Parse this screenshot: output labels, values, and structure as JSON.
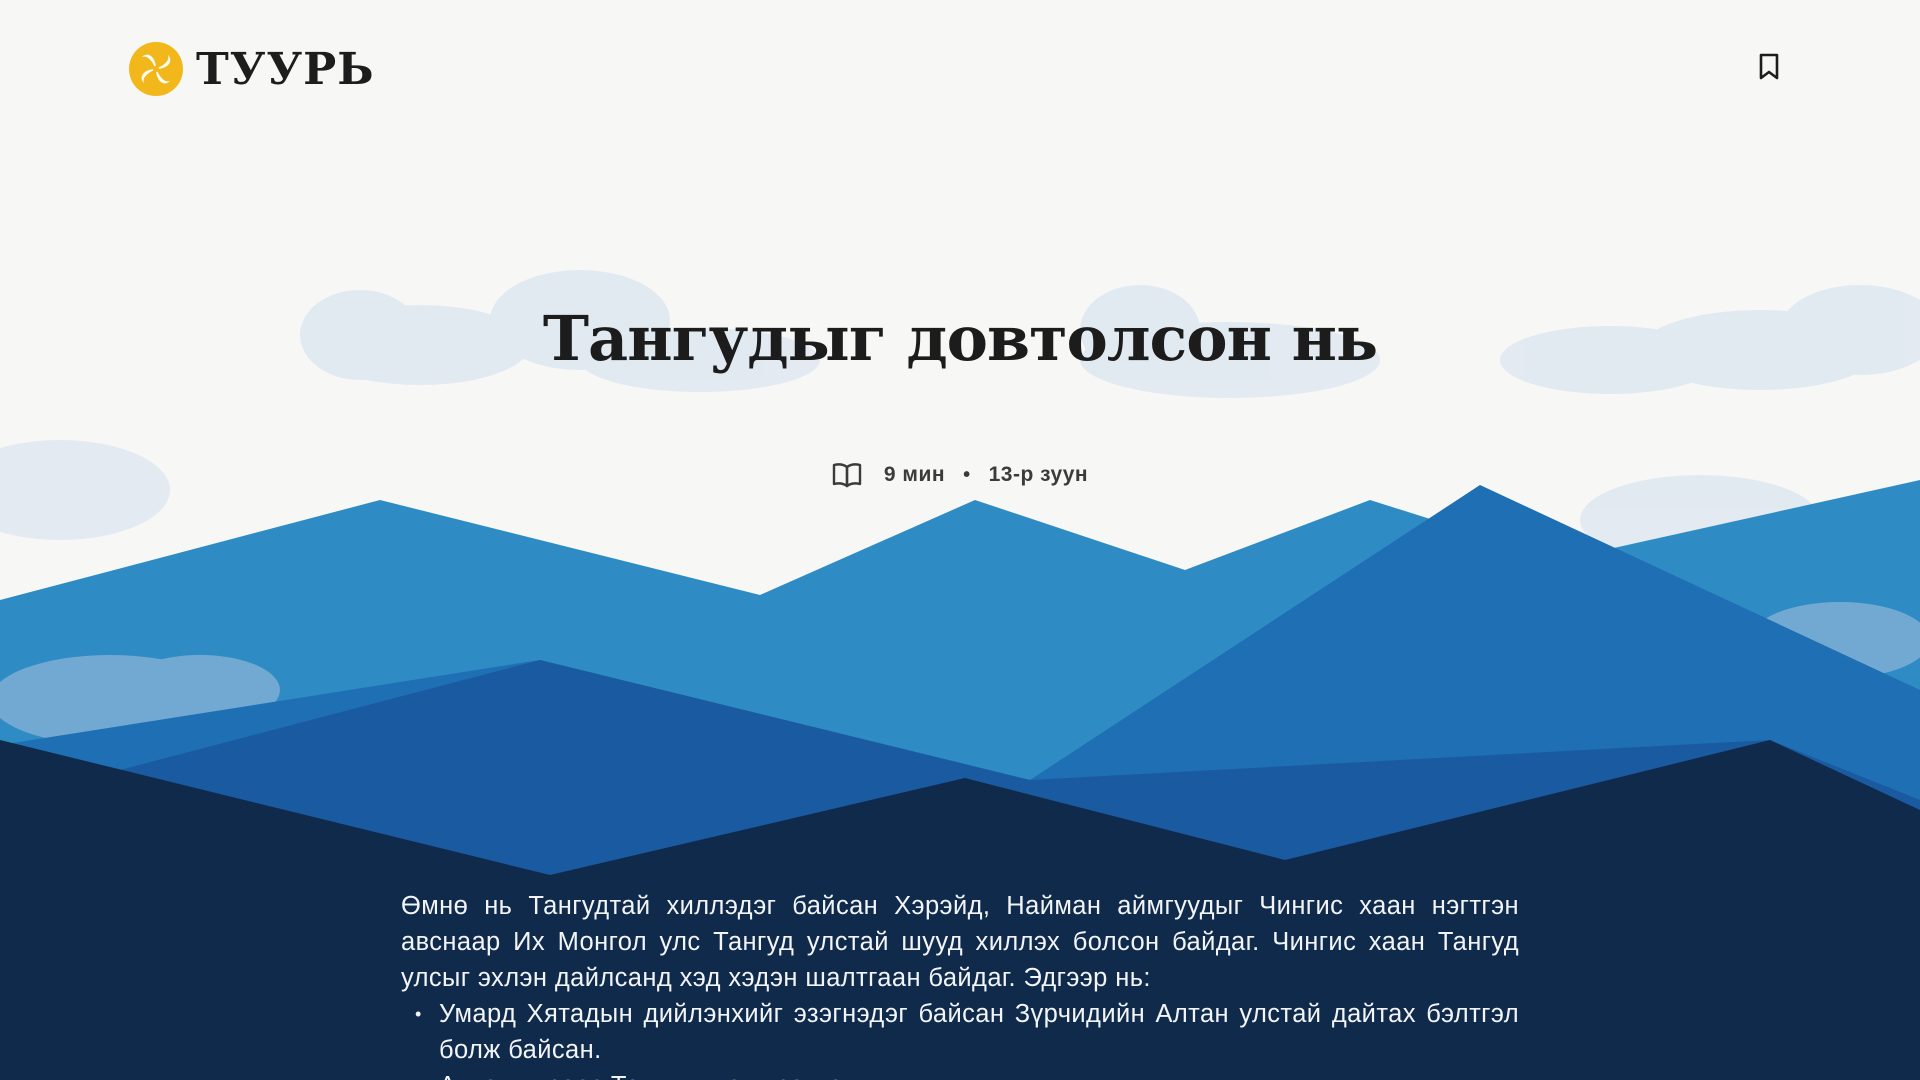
{
  "site": {
    "brand_name": "ТУУРЬ",
    "logo_icon": "swirl-logo-icon",
    "bookmark_icon": "bookmark-icon"
  },
  "article": {
    "title": "Тангудыг довтолсон нь",
    "reading_time": "9 мин",
    "separator": "•",
    "era": "13-р зуун",
    "intro": "Өмнө нь Тангудтай хиллэдэг байсан Хэрэйд, Найман аймгуудыг Чингис хаан нэгтгэн авснаар Их Монгол улс Тангуд улстай шууд хиллэх болсон байдаг. Чингис хаан Тангуд улсыг эхлэн дайлсанд хэд хэдэн шалтгаан байдаг. Эдгээр нь:",
    "reasons": [
      "Умард Хятадын дийлэнхийг эзэгнэдэг байсан Зүрчидийн Алтан улстай дайтах бэлтгэл болж байсан.",
      "Алтан улсаас Тангуд улсыг салгах"
    ]
  },
  "colors": {
    "background": "#f7f7f6",
    "logo_yellow": "#f2b81b",
    "mountain_light": "#2e8bc4",
    "mountain_mid": "#1e6fb3",
    "mountain_deep": "#1a5aa0",
    "mountain_dark": "#0f2a4a",
    "cloud": "#dfe8f1"
  }
}
